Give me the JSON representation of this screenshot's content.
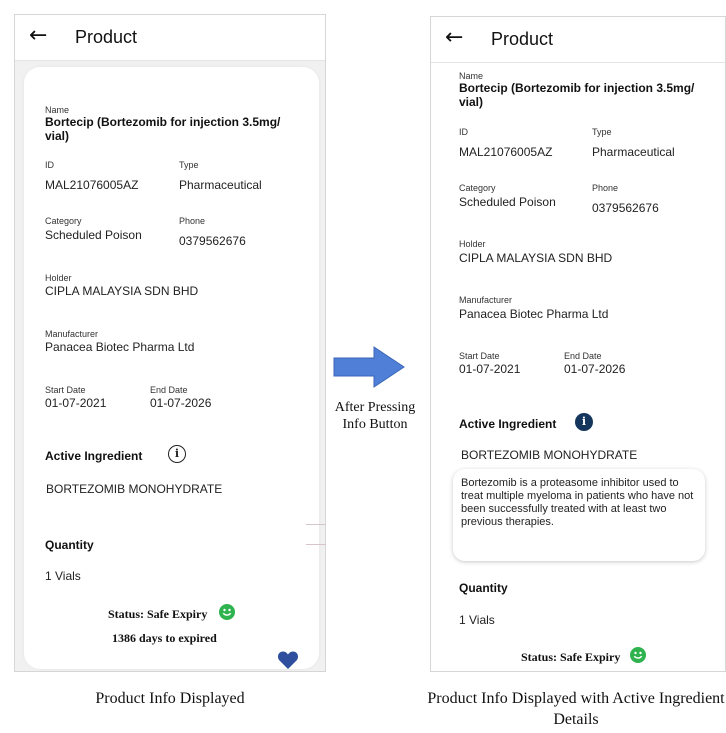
{
  "left_screen": {
    "title": "Product",
    "fields": {
      "name_label": "Name",
      "name_value": "Bortecip (Bortezomib for injection 3.5mg/ vial)",
      "id_label": "ID",
      "id_value": "MAL21076005AZ",
      "type_label": "Type",
      "type_value": "Pharmaceutical",
      "category_label": "Category",
      "category_value": "Scheduled Poison",
      "phone_label": "Phone",
      "phone_value": "0379562676",
      "holder_label": "Holder",
      "holder_value": "CIPLA MALAYSIA SDN BHD",
      "manufacturer_label": "Manufacturer",
      "manufacturer_value": "Panacea Biotec Pharma Ltd",
      "start_date_label": "Start Date",
      "start_date_value": "01-07-2021",
      "end_date_label": "End Date",
      "end_date_value": "01-07-2026"
    },
    "active_ingredient_title": "Active Ingredient",
    "active_ingredient_value": "BORTEZOMIB MONOHYDRATE",
    "quantity_title": "Quantity",
    "quantity_value": "1 Vials",
    "status": "Status: Safe Expiry",
    "days": "1386 days to expired"
  },
  "right_screen": {
    "title": "Product",
    "fields": {
      "name_label": "Name",
      "name_value": "Bortecip (Bortezomib for injection 3.5mg/ vial)",
      "id_label": "ID",
      "id_value": "MAL21076005AZ",
      "type_label": "Type",
      "type_value": "Pharmaceutical",
      "category_label": "Category",
      "category_value": "Scheduled Poison",
      "phone_label": "Phone",
      "phone_value": "0379562676",
      "holder_label": "Holder",
      "holder_value": "CIPLA MALAYSIA SDN BHD",
      "manufacturer_label": "Manufacturer",
      "manufacturer_value": "Panacea Biotec Pharma Ltd",
      "start_date_label": "Start Date",
      "start_date_value": "01-07-2021",
      "end_date_label": "End Date",
      "end_date_value": "01-07-2026"
    },
    "active_ingredient_title": "Active Ingredient",
    "active_ingredient_value": "BORTEZOMIB MONOHYDRATE",
    "ingredient_description": "Bortezomib is a proteasome inhibitor used to treat multiple myeloma in patients who have not been successfully treated with at least two previous therapies.",
    "quantity_title": "Quantity",
    "quantity_value": "1 Vials",
    "status": "Status: Safe Expiry"
  },
  "arrow_caption": "After Pressing Info Button",
  "captions": {
    "left": "Product Info Displayed",
    "right": "Product Info Displayed with Active Ingredient Details"
  },
  "icons": {
    "back": "back-arrow-icon",
    "info": "info-icon",
    "status": "smiley-icon",
    "favorite": "heart-icon"
  },
  "colors": {
    "heart": "#2f4f9e",
    "status_smiley": "#2fb34f",
    "info_filled": "#14365c",
    "arrow": "#4f7fd6"
  }
}
